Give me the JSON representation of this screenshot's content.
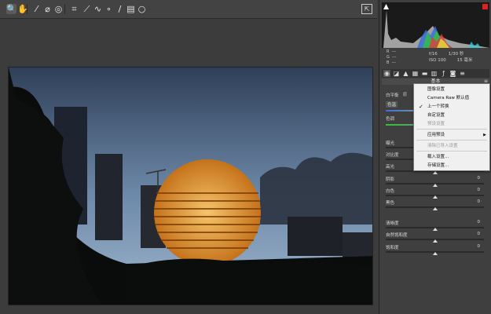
{
  "toolbar": {
    "tools": [
      {
        "icon": "zoom-icon",
        "glyph": "🔍"
      },
      {
        "icon": "hand-icon",
        "glyph": "✋"
      },
      {
        "icon": "white-balance-icon",
        "glyph": "⁄"
      },
      {
        "icon": "color-sampler-icon",
        "glyph": "⌀"
      },
      {
        "icon": "targeted-adjust-icon",
        "glyph": "◎"
      },
      {
        "icon": "crop-icon",
        "glyph": "⌗"
      },
      {
        "icon": "straighten-icon",
        "glyph": "⟋"
      },
      {
        "icon": "spot-removal-icon",
        "glyph": "∿"
      },
      {
        "icon": "redeye-icon",
        "glyph": "∘"
      },
      {
        "icon": "adjustment-brush-icon",
        "glyph": "/"
      },
      {
        "icon": "graduated-filter-icon",
        "glyph": "▤"
      },
      {
        "icon": "radial-filter-icon",
        "glyph": "○"
      }
    ],
    "fullscreen_icon": "fullscreen-icon"
  },
  "readout": {
    "r": "R",
    "g": "G",
    "b": "B",
    "rv": "---",
    "gv": "---",
    "bv": "---",
    "aperture": "f/16",
    "shutter": "1/30 秒",
    "iso": "ISO 100",
    "focal": "15 毫米"
  },
  "panel": {
    "section_title": "基本",
    "wb_label": "白平衡",
    "wb_value": "原",
    "color_label": "色温",
    "tint_label": "色调",
    "sliders": [
      {
        "label": "曝光",
        "value": "",
        "pos": 0.5
      },
      {
        "label": "对比度",
        "value": "",
        "pos": 0.5
      },
      {
        "label": "高光",
        "value": "",
        "pos": 0.5
      },
      {
        "label": "阴影",
        "value": "0",
        "pos": 0.5
      },
      {
        "label": "白色",
        "value": "0",
        "pos": 0.5
      },
      {
        "label": "黑色",
        "value": "0",
        "pos": 0.5
      },
      {
        "label": "清晰度",
        "value": "0",
        "pos": 0.5
      },
      {
        "label": "自然饱和度",
        "value": "0",
        "pos": 0.5
      },
      {
        "label": "饱和度",
        "value": "0",
        "pos": 0.5
      }
    ]
  },
  "dropdown": {
    "items": [
      {
        "label": "图像设置",
        "checked": false,
        "disabled": false,
        "submenu": false
      },
      {
        "label": "Camera Raw 默认值",
        "checked": false,
        "disabled": false,
        "submenu": false
      },
      {
        "label": "上一个转换",
        "checked": true,
        "disabled": false,
        "submenu": false
      },
      {
        "label": "自定设置",
        "checked": false,
        "disabled": false,
        "submenu": false
      },
      {
        "label": "预设设置",
        "checked": false,
        "disabled": true,
        "submenu": false
      },
      {
        "label": "应用预设",
        "checked": false,
        "disabled": false,
        "submenu": true
      },
      {
        "label": "清除已导入设置",
        "checked": false,
        "disabled": true,
        "submenu": false
      },
      {
        "label": "载入设置...",
        "checked": false,
        "disabled": false,
        "submenu": false
      },
      {
        "label": "存储设置...",
        "checked": false,
        "disabled": false,
        "submenu": false
      }
    ]
  },
  "colors": {
    "panel_bg": "#3f3f3f",
    "toolbar_bg": "#434343",
    "sky_top": "#3b4e6a",
    "sky_bottom": "#8aa6c4",
    "dome": "#e9a23a"
  }
}
